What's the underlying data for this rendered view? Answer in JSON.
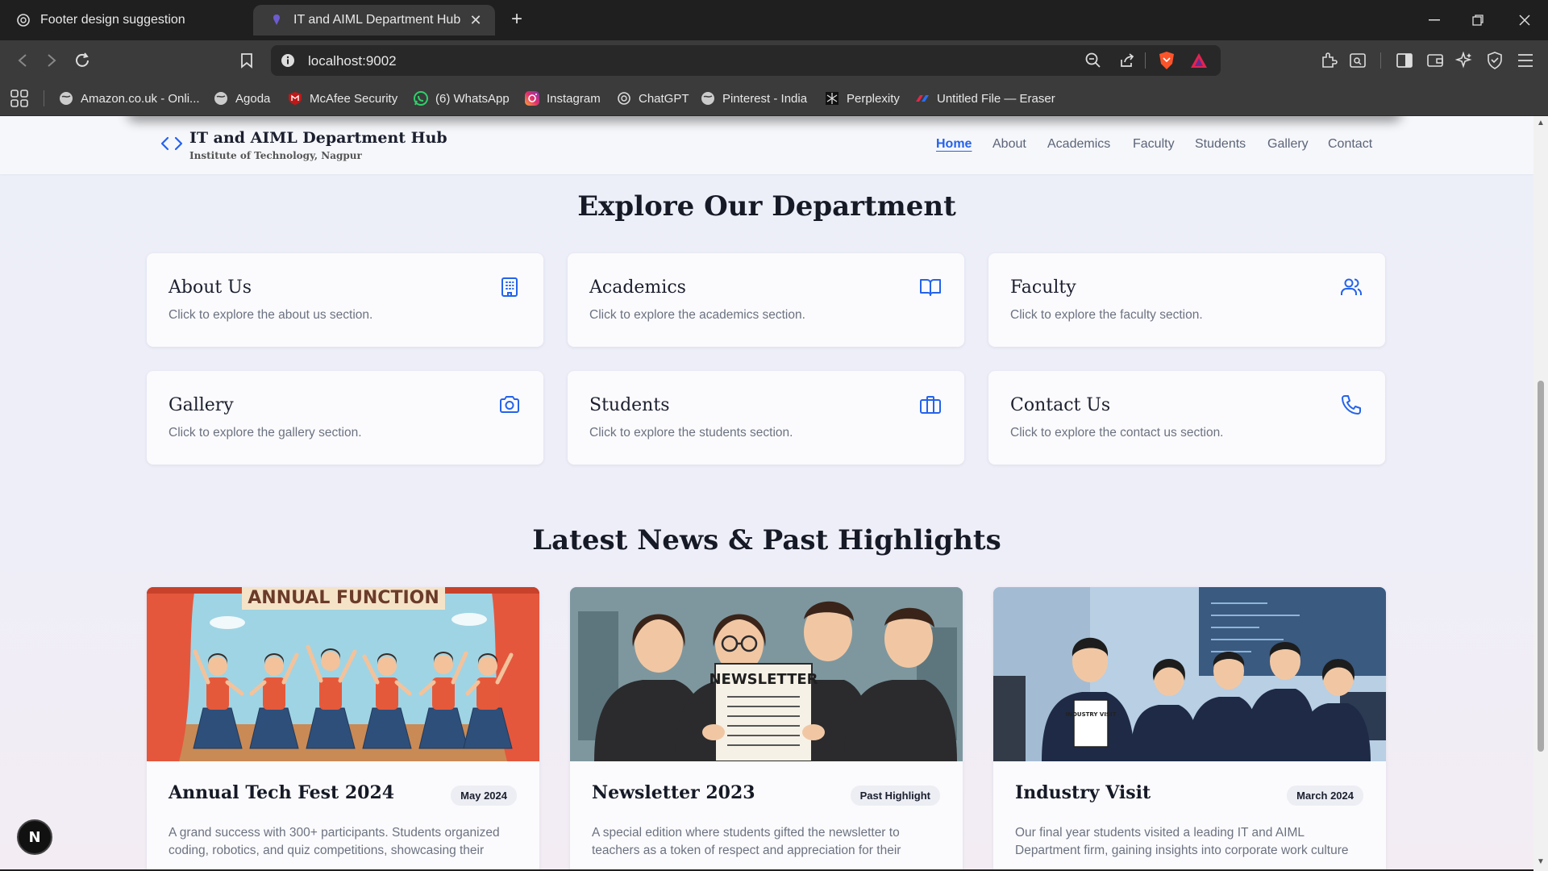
{
  "browser": {
    "tabs": [
      {
        "title": "Footer design suggestion"
      },
      {
        "title": "IT and AIML Department Hub"
      }
    ],
    "url": "localhost:9002",
    "bookmarks": [
      {
        "label": "Amazon.co.uk - Onli..."
      },
      {
        "label": "Agoda"
      },
      {
        "label": "McAfee Security"
      },
      {
        "label": "(6) WhatsApp"
      },
      {
        "label": "Instagram"
      },
      {
        "label": "ChatGPT"
      },
      {
        "label": "Pinterest - India"
      },
      {
        "label": "Perplexity"
      },
      {
        "label": "Untitled File — Eraser"
      }
    ]
  },
  "site": {
    "title": "IT and AIML Department Hub",
    "subtitle": "Institute of Technology, Nagpur",
    "nav": [
      "Home",
      "About",
      "Academics",
      "Faculty",
      "Students",
      "Gallery",
      "Contact"
    ],
    "active_nav": "Home"
  },
  "explore": {
    "heading": "Explore Our Department",
    "cards": [
      {
        "title": "About Us",
        "desc": "Click to explore the about us section.",
        "icon": "building-icon"
      },
      {
        "title": "Academics",
        "desc": "Click to explore the academics section.",
        "icon": "book-icon"
      },
      {
        "title": "Faculty",
        "desc": "Click to explore the faculty section.",
        "icon": "users-icon"
      },
      {
        "title": "Gallery",
        "desc": "Click to explore the gallery section.",
        "icon": "camera-icon"
      },
      {
        "title": "Students",
        "desc": "Click to explore the students section.",
        "icon": "briefcase-icon"
      },
      {
        "title": "Contact Us",
        "desc": "Click to explore the contact us section.",
        "icon": "phone-icon"
      }
    ]
  },
  "news": {
    "heading": "Latest News & Past Highlights",
    "items": [
      {
        "title": "Annual Tech Fest 2024",
        "badge": "May 2024",
        "image_text": "ANNUAL FUNCTION",
        "desc": "A grand success with 300+ participants. Students organized coding, robotics, and quiz competitions, showcasing their"
      },
      {
        "title": "Newsletter 2023",
        "badge": "Past Highlight",
        "image_text": "NEWSLETTER",
        "desc": "A special edition where students gifted the newsletter to teachers as a token of respect and appreciation for their"
      },
      {
        "title": "Industry Visit",
        "badge": "March 2024",
        "image_text": "INDUSTRY VISIT",
        "desc": "Our final year students visited a leading IT and AIML Department firm, gaining insights into corporate work culture"
      }
    ]
  },
  "colors": {
    "accent": "#2563eb",
    "heading": "#151a26",
    "muted": "#6b7280"
  },
  "dev_badge": {
    "label": "N"
  }
}
